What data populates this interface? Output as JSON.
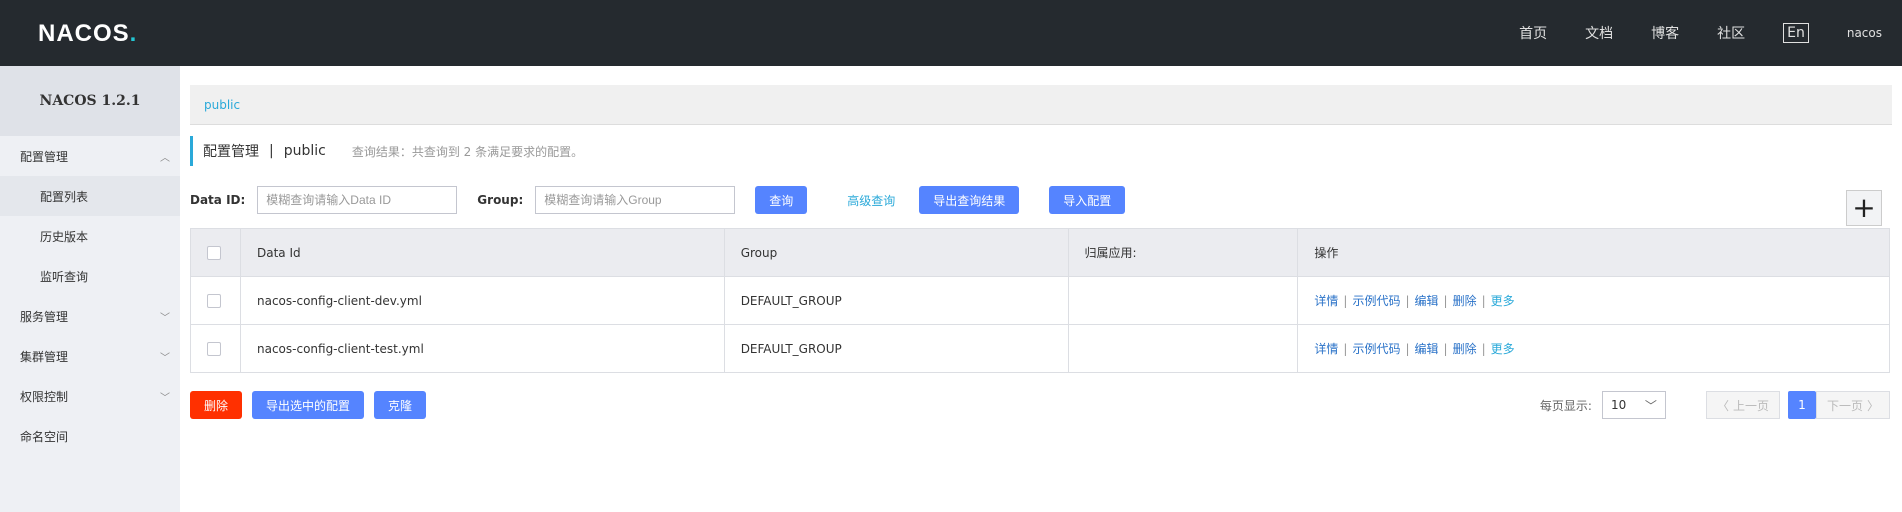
{
  "header": {
    "logo": "NACOS",
    "logo_dot": ".",
    "nav": [
      "首页",
      "文档",
      "博客",
      "社区"
    ],
    "lang": "En",
    "user": "nacos"
  },
  "sidebar": {
    "title": "NACOS 1.2.1",
    "groups": [
      {
        "label": "配置管理",
        "expanded": true,
        "icon": "chevron-up-icon",
        "items": [
          {
            "label": "配置列表",
            "active": true
          },
          {
            "label": "历史版本"
          },
          {
            "label": "监听查询"
          }
        ]
      },
      {
        "label": "服务管理",
        "icon": "chevron-down-icon"
      },
      {
        "label": "集群管理",
        "icon": "chevron-down-icon"
      },
      {
        "label": "权限控制",
        "icon": "chevron-down-icon"
      },
      {
        "label": "命名空间"
      }
    ]
  },
  "namespace_bar": {
    "current": "public"
  },
  "page_head": {
    "title": "配置管理",
    "separator": "|",
    "namespace": "public",
    "result": "查询结果：共查询到 2 条满足要求的配置。"
  },
  "search": {
    "data_id_label": "Data ID:",
    "data_id_placeholder": "模糊查询请输入Data ID",
    "group_label": "Group:",
    "group_placeholder": "模糊查询请输入Group",
    "query_button": "查询",
    "advanced_link": "高级查询",
    "export_button": "导出查询结果",
    "import_button": "导入配置",
    "add_symbol": "+"
  },
  "table": {
    "columns": [
      "Data Id",
      "Group",
      "归属应用:",
      "操作"
    ],
    "rows": [
      {
        "data_id": "nacos-config-client-dev.yml",
        "group": "DEFAULT_GROUP",
        "app": ""
      },
      {
        "data_id": "nacos-config-client-test.yml",
        "group": "DEFAULT_GROUP",
        "app": ""
      }
    ],
    "ops": [
      "详情",
      "示例代码",
      "编辑",
      "删除",
      "更多"
    ],
    "op_separator": "|"
  },
  "bottom": {
    "delete_button": "删除",
    "export_selected_button": "导出选中的配置",
    "clone_button": "克隆",
    "page_size_label": "每页显示:",
    "page_size": "10",
    "prev": "上一页",
    "current_page": "1",
    "next": "下一页"
  },
  "colors": {
    "header_bg": "#252a2f",
    "accent": "#2aa9d9",
    "primary_button": "#5584ff",
    "danger_button": "#ff3000"
  }
}
